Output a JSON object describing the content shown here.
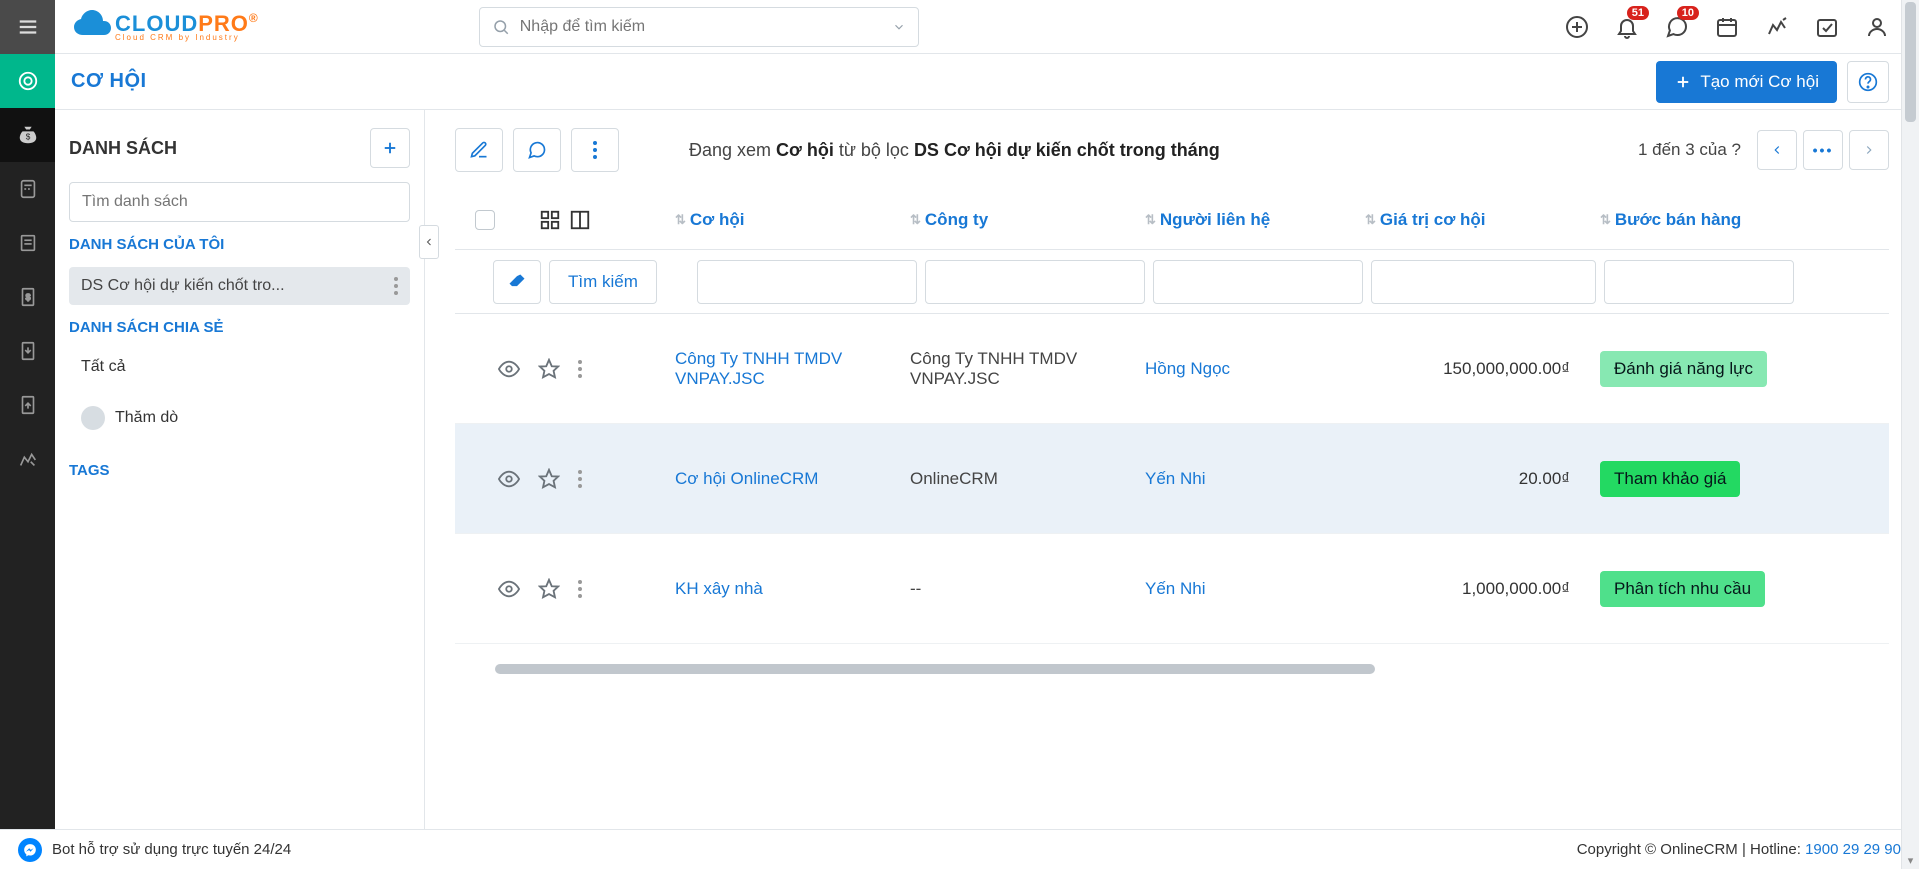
{
  "brand": {
    "cloud": "CLOUD",
    "pro": "PRO",
    "tagline": "Cloud CRM by Industry"
  },
  "topbar": {
    "searchPlaceholder": "Nhập để tìm kiếm",
    "notifBadge": "51",
    "chatBadge": "10"
  },
  "subheader": {
    "title": "CƠ HỘI",
    "createLabel": "Tạo mới Cơ hội"
  },
  "sidebar": {
    "listTitle": "DANH SÁCH",
    "searchPlaceholder": "Tìm danh sách",
    "myLists": "DANH SÁCH CỦA TÔI",
    "activeList": "DS Cơ hội dự kiến chốt tro...",
    "sharedLists": "DANH SÁCH CHIA SẺ",
    "allLabel": "Tất cả",
    "probeLabel": "Thăm dò",
    "tagsLabel": "TAGS"
  },
  "main": {
    "viewingPrefix": "Đang xem ",
    "viewingEntity": "Cơ hội",
    "viewingMiddle": " từ bộ lọc ",
    "viewingFilter": "DS Cơ hội dự kiến chốt trong tháng",
    "pagerText": "1 đến 3 của  ?",
    "searchLabel": "Tìm kiếm",
    "columns": {
      "opportunity": "Cơ hội",
      "company": "Công ty",
      "contact": "Người liên hệ",
      "value": "Giá trị cơ hội",
      "step": "Bước bán hàng"
    },
    "rows": [
      {
        "op": "Công Ty TNHH TMDV VNPAY.JSC",
        "company": "Công Ty TNHH TMDV VNPAY.JSC",
        "companyIsLink": true,
        "contact": "Hồng Ngọc",
        "value": "150,000,000.00₫",
        "step": "Đánh giá năng lực",
        "stepColor": "#87e8b2"
      },
      {
        "op": "Cơ hội OnlineCRM",
        "company": "OnlineCRM",
        "companyIsLink": true,
        "contact": "Yến Nhi",
        "value": "20.00₫",
        "step": "Tham khảo giá",
        "stepColor": "#23d962",
        "highlight": true
      },
      {
        "op": "KH xây nhà",
        "company": "--",
        "companyIsLink": false,
        "contact": "Yến Nhi",
        "value": "1,000,000.00₫",
        "step": "Phân tích nhu cầu",
        "stepColor": "#4fe08b"
      }
    ]
  },
  "footer": {
    "botText": "Bot hỗ trợ sử dụng trực tuyến 24/24",
    "copyright": "Copyright © OnlineCRM",
    "hotlineLabel": "Hotline:",
    "hotline": "1900 29 29 90"
  }
}
